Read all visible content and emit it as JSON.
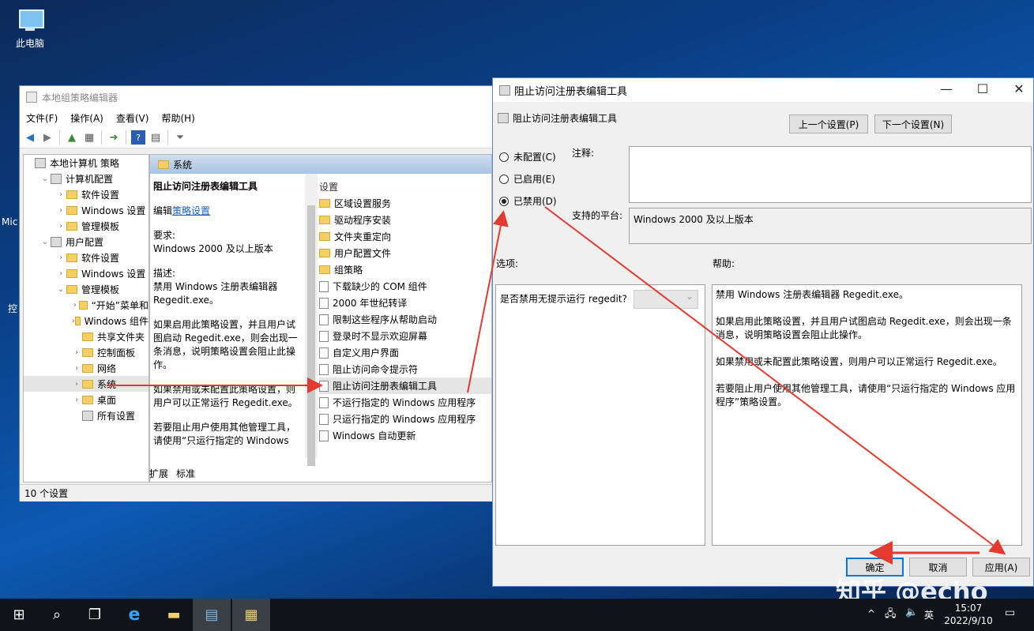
{
  "desktop": {
    "icon_label": "此电脑",
    "edge_labels": [
      "Mic",
      "控"
    ]
  },
  "gpedit": {
    "title": "本地组策略编辑器",
    "menu": [
      "文件(F)",
      "操作(A)",
      "查看(V)",
      "帮助(H)"
    ],
    "tree": [
      {
        "label": "本地计算机 策略",
        "level": 0,
        "expander": "",
        "icon": "policy"
      },
      {
        "label": "计算机配置",
        "level": 1,
        "expander": "v",
        "icon": "computer"
      },
      {
        "label": "软件设置",
        "level": 2,
        "expander": ">",
        "icon": "folder"
      },
      {
        "label": "Windows 设置",
        "level": 2,
        "expander": ">",
        "icon": "folder"
      },
      {
        "label": "管理模板",
        "level": 2,
        "expander": ">",
        "icon": "folder"
      },
      {
        "label": "用户配置",
        "level": 1,
        "expander": "v",
        "icon": "user"
      },
      {
        "label": "软件设置",
        "level": 2,
        "expander": ">",
        "icon": "folder"
      },
      {
        "label": "Windows 设置",
        "level": 2,
        "expander": ">",
        "icon": "folder"
      },
      {
        "label": "管理模板",
        "level": 2,
        "expander": "v",
        "icon": "folder"
      },
      {
        "label": "“开始”菜单和",
        "level": 3,
        "expander": ">",
        "icon": "folder"
      },
      {
        "label": "Windows 组件",
        "level": 3,
        "expander": ">",
        "icon": "folder"
      },
      {
        "label": "共享文件夹",
        "level": 3,
        "expander": "",
        "icon": "folder"
      },
      {
        "label": "控制面板",
        "level": 3,
        "expander": ">",
        "icon": "folder"
      },
      {
        "label": "网络",
        "level": 3,
        "expander": ">",
        "icon": "folder"
      },
      {
        "label": "系统",
        "level": 3,
        "expander": ">",
        "icon": "folder",
        "selected": true
      },
      {
        "label": "桌面",
        "level": 3,
        "expander": ">",
        "icon": "folder"
      },
      {
        "label": "所有设置",
        "level": 3,
        "expander": "",
        "icon": "settings"
      }
    ],
    "header": "系统",
    "desc": {
      "title": "阻止访问注册表编辑工具",
      "edit_prefix": "编辑",
      "edit_link": "策略设置",
      "req_label": "要求:",
      "req_value": "Windows 2000 及以上版本",
      "desc_label": "描述:",
      "desc_text": "禁用 Windows 注册表编辑器 Regedit.exe。",
      "p1": "如果启用此策略设置，并且用户试图启动 Regedit.exe，则会出现一条消息，说明策略设置会阻止此操作。",
      "p2": "如果禁用或未配置此策略设置，则用户可以正常运行 Regedit.exe。",
      "p3": "若要阻止用户使用其他管理工具，请使用“只运行指定的 Windows"
    },
    "settings_header": "设置",
    "settings": [
      {
        "label": "区域设置服务",
        "icon": "folder"
      },
      {
        "label": "驱动程序安装",
        "icon": "folder"
      },
      {
        "label": "文件夹重定向",
        "icon": "folder"
      },
      {
        "label": "用户配置文件",
        "icon": "folder"
      },
      {
        "label": "组策略",
        "icon": "folder"
      },
      {
        "label": "下载缺少的 COM 组件",
        "icon": "page"
      },
      {
        "label": "2000 年世纪转译",
        "icon": "page"
      },
      {
        "label": "限制这些程序从帮助启动",
        "icon": "page"
      },
      {
        "label": "登录时不显示欢迎屏幕",
        "icon": "page"
      },
      {
        "label": "自定义用户界面",
        "icon": "page"
      },
      {
        "label": "阻止访问命令提示符",
        "icon": "page"
      },
      {
        "label": "阻止访问注册表编辑工具",
        "icon": "page",
        "selected": true
      },
      {
        "label": "不运行指定的 Windows 应用程序",
        "icon": "page"
      },
      {
        "label": "只运行指定的 Windows 应用程序",
        "icon": "page"
      },
      {
        "label": "Windows 自动更新",
        "icon": "page"
      }
    ],
    "tabs": [
      "扩展",
      "标准"
    ],
    "status": "10 个设置"
  },
  "dialog": {
    "title": "阻止访问注册表编辑工具",
    "subtitle": "阻止访问注册表编辑工具",
    "prev_btn": "上一个设置(P)",
    "next_btn": "下一个设置(N)",
    "radios": [
      {
        "label": "未配置(C)",
        "checked": false
      },
      {
        "label": "已启用(E)",
        "checked": false
      },
      {
        "label": "已禁用(D)",
        "checked": true
      }
    ],
    "comment_label": "注释:",
    "platform_label": "支持的平台:",
    "platform_value": "Windows 2000 及以上版本",
    "options_label": "选项:",
    "help_label": "帮助:",
    "option_text": "是否禁用无提示运行 regedit?",
    "help": [
      "禁用 Windows 注册表编辑器 Regedit.exe。",
      "如果启用此策略设置，并且用户试图启动 Regedit.exe，则会出现一条消息，说明策略设置会阻止此操作。",
      "如果禁用或未配置此策略设置，则用户可以正常运行 Regedit.exe。",
      "若要阻止用户使用其他管理工具，请使用“只运行指定的 Windows 应用程序”策略设置。"
    ],
    "ok": "确定",
    "cancel": "取消",
    "apply": "应用(A)"
  },
  "taskbar": {
    "time": "15:07",
    "date": "2022/9/10",
    "ime": "英"
  },
  "watermark": "知乎 @echo",
  "colors": {
    "arrow": "#e53a2f",
    "selection": "#cce8ff",
    "accent": "#0078d7"
  }
}
